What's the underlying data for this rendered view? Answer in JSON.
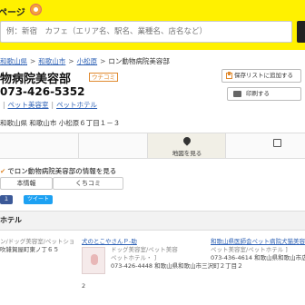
{
  "header": {
    "brand": "ページ",
    "search_placeholder": "例：新宿　カフェ（エリア名、駅名、業種名、店名など）"
  },
  "breadcrumb": [
    "和歌山県",
    "和歌山市",
    "小松原",
    "ロン動物病院美容部"
  ],
  "title": "物病院美容部",
  "badge": "ウチコミ",
  "save_label": "保存リストに追加する",
  "print_label": "印刷する",
  "phone": "073-426-5352",
  "tags": [
    " ",
    "ペット美容室",
    "ペットホテル"
  ],
  "address": "和歌山県 和歌山市 小松原６丁目１－３",
  "actions": {
    "map_label": "地図を見る"
  },
  "info": {
    "heading": "でロン動物病院美容部の情報を見る",
    "tab_basic": "本情報",
    "tab_review": "くちコミ"
  },
  "share": {
    "fb": "１",
    "tw": "ツイート"
  },
  "nearby": {
    "heading": "ホテル",
    "col1": {
      "cat": "ン/ドッグ美容室/ペットショ",
      "addr": "吹雑賀屋町東ノ丁６５"
    },
    "col2": {
      "name": "犬のとこやさんＰ-助",
      "cat": "ドッグ美容室/ペット美容",
      "cat2": "ペットホテル・ ]",
      "phone": "073-426-4448",
      "addr": "和歌山県和歌山市三沢町２丁目２"
    },
    "col3": {
      "name": "和歌山県医師会ペット病院犬猫美容部",
      "cat": "ペット美容室/ペットホテル ]",
      "phone": "073-436-4614",
      "addr": "和歌山県和歌山市広瀬通丁２丁目６"
    },
    "extra": "2"
  }
}
